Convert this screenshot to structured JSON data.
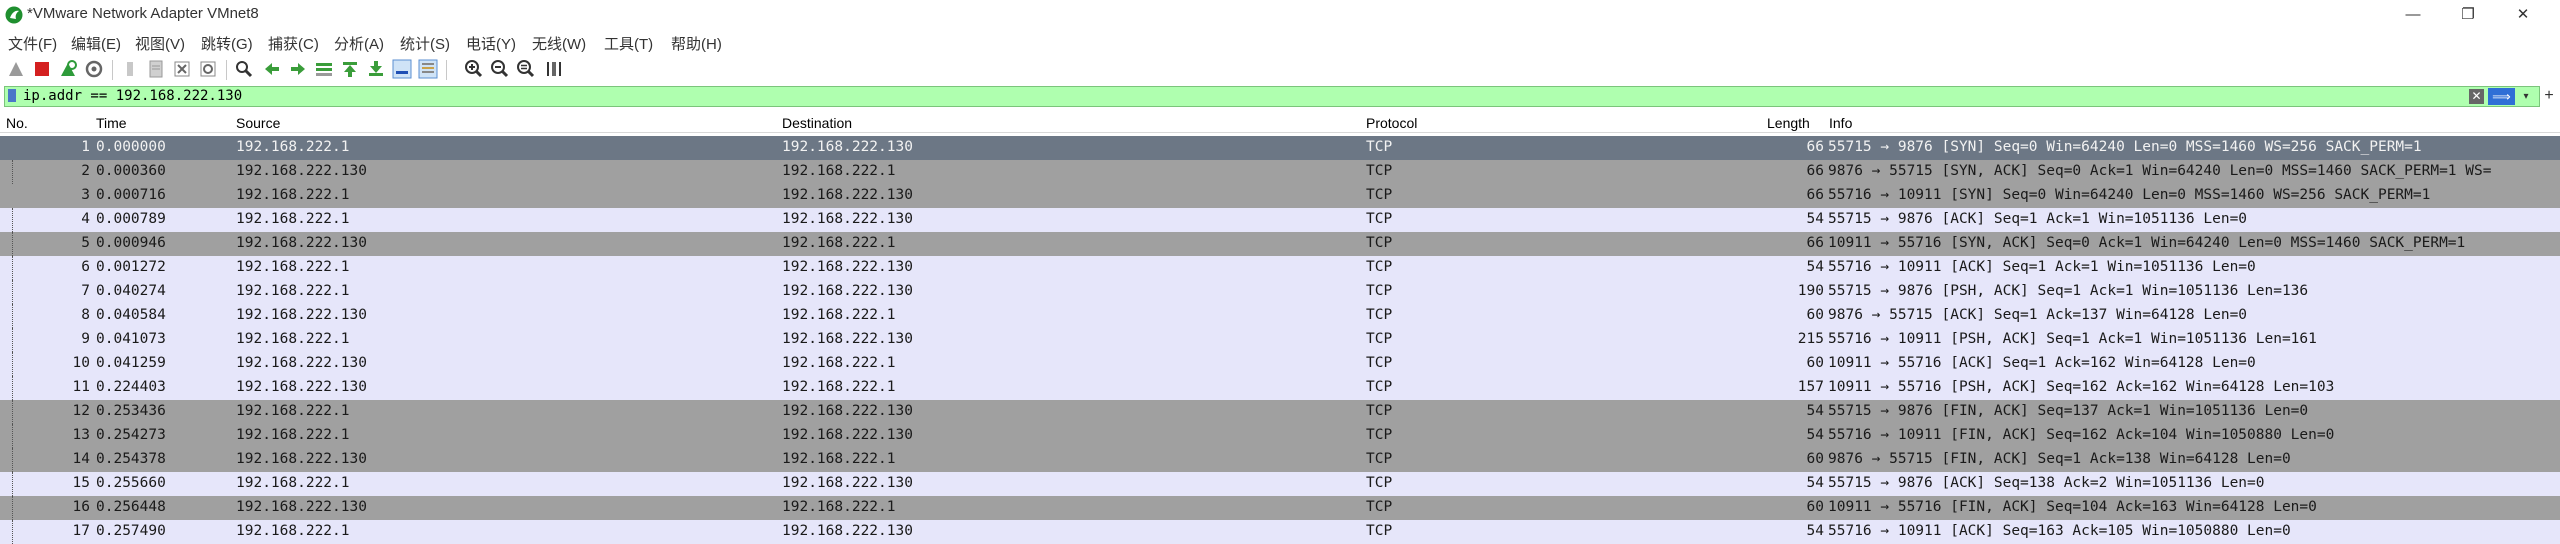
{
  "window": {
    "title": "*VMware Network Adapter VMnet8",
    "minimize": "—",
    "maximize": "❐",
    "close": "✕"
  },
  "menu": [
    "文件(F)",
    "编辑(E)",
    "视图(V)",
    "跳转(G)",
    "捕获(C)",
    "分析(A)",
    "统计(S)",
    "电话(Y)",
    "无线(W)",
    "工具(T)",
    "帮助(H)"
  ],
  "toolbar_icons": [
    "start-capture-icon",
    "stop-capture-icon",
    "restart-capture-icon",
    "capture-options-icon",
    "open-file-icon",
    "save-file-icon",
    "close-file-icon",
    "reload-file-icon",
    "find-packet-icon",
    "go-back-icon",
    "go-forward-icon",
    "go-to-packet-icon",
    "go-first-icon",
    "go-last-icon",
    "autoscroll-icon",
    "colorize-icon",
    "zoom-in-icon",
    "zoom-out-icon",
    "zoom-normal-icon",
    "resize-columns-icon"
  ],
  "filter": {
    "value": "ip.addr == 192.168.222.130",
    "clear": "✕",
    "apply": "⟹",
    "dropdown": "▾",
    "add": "+"
  },
  "columns": [
    "No.",
    "Time",
    "Source",
    "Destination",
    "Protocol",
    "Length",
    "Info"
  ],
  "packets": [
    {
      "no": "1",
      "time": "0.000000",
      "src": "192.168.222.1",
      "dst": "192.168.222.130",
      "proto": "TCP",
      "len": "66",
      "info": "55715 → 9876 [SYN] Seq=0 Win=64240 Len=0 MSS=1460 WS=256 SACK_PERM=1",
      "style": "selected"
    },
    {
      "no": "2",
      "time": "0.000360",
      "src": "192.168.222.130",
      "dst": "192.168.222.1",
      "proto": "TCP",
      "len": "66",
      "info": "9876 → 55715 [SYN, ACK] Seq=0 Ack=1 Win=64240 Len=0 MSS=1460 SACK_PERM=1 WS=",
      "style": "dark"
    },
    {
      "no": "3",
      "time": "0.000716",
      "src": "192.168.222.1",
      "dst": "192.168.222.130",
      "proto": "TCP",
      "len": "66",
      "info": "55716 → 10911 [SYN] Seq=0 Win=64240 Len=0 MSS=1460 WS=256 SACK_PERM=1",
      "style": "dark"
    },
    {
      "no": "4",
      "time": "0.000789",
      "src": "192.168.222.1",
      "dst": "192.168.222.130",
      "proto": "TCP",
      "len": "54",
      "info": "55715 → 9876 [ACK] Seq=1 Ack=1 Win=1051136 Len=0",
      "style": "light"
    },
    {
      "no": "5",
      "time": "0.000946",
      "src": "192.168.222.130",
      "dst": "192.168.222.1",
      "proto": "TCP",
      "len": "66",
      "info": "10911 → 55716 [SYN, ACK] Seq=0 Ack=1 Win=64240 Len=0 MSS=1460 SACK_PERM=1",
      "style": "dark"
    },
    {
      "no": "6",
      "time": "0.001272",
      "src": "192.168.222.1",
      "dst": "192.168.222.130",
      "proto": "TCP",
      "len": "54",
      "info": "55716 → 10911 [ACK] Seq=1 Ack=1 Win=1051136 Len=0",
      "style": "light"
    },
    {
      "no": "7",
      "time": "0.040274",
      "src": "192.168.222.1",
      "dst": "192.168.222.130",
      "proto": "TCP",
      "len": "190",
      "info": "55715 → 9876 [PSH, ACK] Seq=1 Ack=1 Win=1051136 Len=136",
      "style": "light"
    },
    {
      "no": "8",
      "time": "0.040584",
      "src": "192.168.222.130",
      "dst": "192.168.222.1",
      "proto": "TCP",
      "len": "60",
      "info": "9876 → 55715 [ACK] Seq=1 Ack=137 Win=64128 Len=0",
      "style": "light"
    },
    {
      "no": "9",
      "time": "0.041073",
      "src": "192.168.222.1",
      "dst": "192.168.222.130",
      "proto": "TCP",
      "len": "215",
      "info": "55716 → 10911 [PSH, ACK] Seq=1 Ack=1 Win=1051136 Len=161",
      "style": "light"
    },
    {
      "no": "10",
      "time": "0.041259",
      "src": "192.168.222.130",
      "dst": "192.168.222.1",
      "proto": "TCP",
      "len": "60",
      "info": "10911 → 55716 [ACK] Seq=1 Ack=162 Win=64128 Len=0",
      "style": "light"
    },
    {
      "no": "11",
      "time": "0.224403",
      "src": "192.168.222.130",
      "dst": "192.168.222.1",
      "proto": "TCP",
      "len": "157",
      "info": "10911 → 55716 [PSH, ACK] Seq=162 Ack=162 Win=64128 Len=103",
      "style": "light"
    },
    {
      "no": "12",
      "time": "0.253436",
      "src": "192.168.222.1",
      "dst": "192.168.222.130",
      "proto": "TCP",
      "len": "54",
      "info": "55715 → 9876 [FIN, ACK] Seq=137 Ack=1 Win=1051136 Len=0",
      "style": "dark"
    },
    {
      "no": "13",
      "time": "0.254273",
      "src": "192.168.222.1",
      "dst": "192.168.222.130",
      "proto": "TCP",
      "len": "54",
      "info": "55716 → 10911 [FIN, ACK] Seq=162 Ack=104 Win=1050880 Len=0",
      "style": "dark"
    },
    {
      "no": "14",
      "time": "0.254378",
      "src": "192.168.222.130",
      "dst": "192.168.222.1",
      "proto": "TCP",
      "len": "60",
      "info": "9876 → 55715 [FIN, ACK] Seq=1 Ack=138 Win=64128 Len=0",
      "style": "dark"
    },
    {
      "no": "15",
      "time": "0.255660",
      "src": "192.168.222.1",
      "dst": "192.168.222.130",
      "proto": "TCP",
      "len": "54",
      "info": "55715 → 9876 [ACK] Seq=138 Ack=2 Win=1051136 Len=0",
      "style": "light"
    },
    {
      "no": "16",
      "time": "0.256448",
      "src": "192.168.222.130",
      "dst": "192.168.222.1",
      "proto": "TCP",
      "len": "60",
      "info": "10911 → 55716 [FIN, ACK] Seq=104 Ack=163 Win=64128 Len=0",
      "style": "dark"
    },
    {
      "no": "17",
      "time": "0.257490",
      "src": "192.168.222.1",
      "dst": "192.168.222.130",
      "proto": "TCP",
      "len": "54",
      "info": "55716 → 10911 [ACK] Seq=163 Ack=105 Win=1050880 Len=0",
      "style": "light"
    }
  ],
  "colors": {
    "filter_valid_bg": "#afffaf",
    "row_light": "#e6e6fa",
    "row_dark": "#a0a0a0",
    "row_selected": "#6c7785"
  }
}
